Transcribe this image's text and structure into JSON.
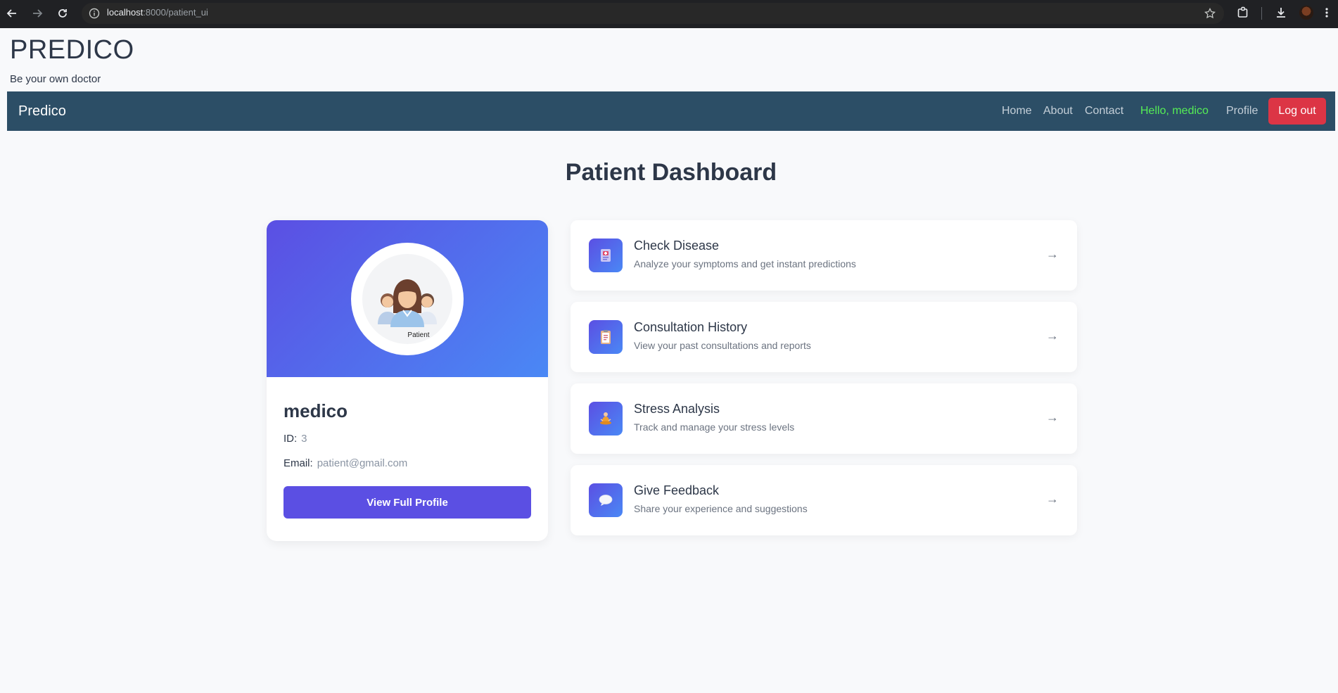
{
  "browser": {
    "url_host": "localhost",
    "url_rest": ":8000/patient_ui"
  },
  "site": {
    "title": "PREDICO",
    "tagline": "Be your own doctor"
  },
  "navbar": {
    "logo": "Predico",
    "links": [
      "Home",
      "About",
      "Contact"
    ],
    "greeting": "Hello, medico",
    "profile": "Profile",
    "logout": "Log out"
  },
  "page": {
    "heading": "Patient Dashboard"
  },
  "profile": {
    "avatar_label": "Patient",
    "name": "medico",
    "id_label": "ID:",
    "id_value": "3",
    "email_label": "Email:",
    "email_value": "patient@gmail.com",
    "button": "View Full Profile"
  },
  "actions": [
    {
      "title": "Check Disease",
      "desc": "Analyze your symptoms and get instant predictions",
      "icon": "diagnosis-icon",
      "arrow": "→"
    },
    {
      "title": "Consultation History",
      "desc": "View your past consultations and reports",
      "icon": "clipboard-icon",
      "arrow": "→"
    },
    {
      "title": "Stress Analysis",
      "desc": "Track and manage your stress levels",
      "icon": "meditation-icon",
      "arrow": "→"
    },
    {
      "title": "Give Feedback",
      "desc": "Share your experience and suggestions",
      "icon": "speech-bubble-icon",
      "arrow": "→"
    }
  ],
  "colors": {
    "navbar": "#2c4e66",
    "accent": "#5b4fe3",
    "logout": "#dc3545",
    "greeting": "#55ee55"
  }
}
